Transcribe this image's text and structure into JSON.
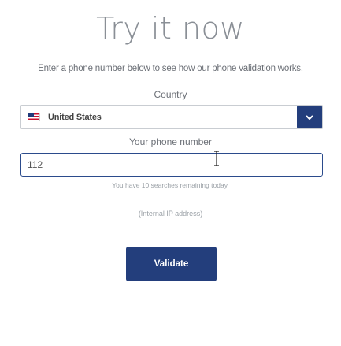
{
  "title": "Try it now",
  "intro": "Enter a phone number below to see how our phone validation works.",
  "country": {
    "label": "Country",
    "selected": "United States",
    "flag_icon": "us-flag-icon",
    "toggle_icon": "chevron-down-icon"
  },
  "phone": {
    "label": "Your phone number",
    "value": "112"
  },
  "remaining": "You have 10 searches remaining today.",
  "ip": "(Internal IP address)",
  "validate_label": "Validate",
  "colors": {
    "accent": "#233e7c",
    "text": "#6b6f76",
    "muted": "#9aa0a6"
  }
}
